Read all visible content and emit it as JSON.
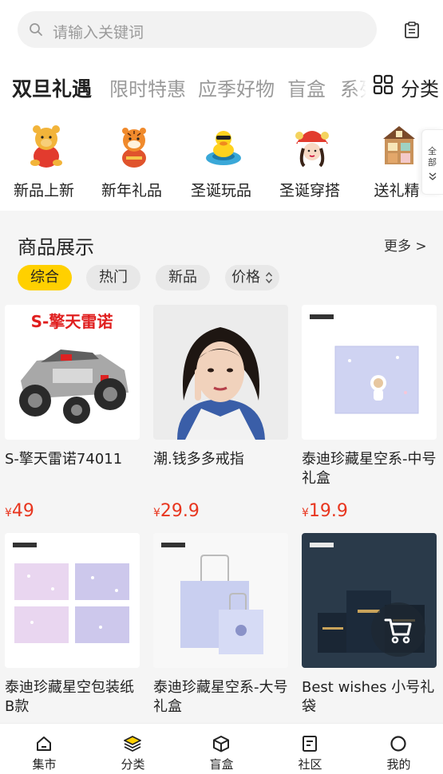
{
  "search": {
    "placeholder": "请输入关键词"
  },
  "tabs": [
    {
      "label": "双旦礼遇"
    },
    {
      "label": "限时特惠"
    },
    {
      "label": "应季好物"
    },
    {
      "label": "盲盒"
    },
    {
      "label": "系列"
    }
  ],
  "category_button": {
    "label": "分类"
  },
  "quick_categories": [
    {
      "label": "新品上新",
      "icon": "pooh-bear-icon"
    },
    {
      "label": "新年礼品",
      "icon": "tiger-plush-icon"
    },
    {
      "label": "圣诞玩品",
      "icon": "duck-float-icon"
    },
    {
      "label": "圣诞穿搭",
      "icon": "lion-hat-girl-icon"
    },
    {
      "label": "送礼精",
      "icon": "dollhouse-icon"
    }
  ],
  "all_button": {
    "label": "全部"
  },
  "section": {
    "title": "商品展示",
    "more": "更多 >"
  },
  "filters": [
    {
      "label": "综合",
      "active": true
    },
    {
      "label": "热门",
      "active": false
    },
    {
      "label": "新品",
      "active": false
    },
    {
      "label": "价格",
      "active": false
    }
  ],
  "products": [
    {
      "name": "S-擎天雷诺74011",
      "price_symbol": "¥",
      "price": "49",
      "image_text": "S-擎天雷诺"
    },
    {
      "name": "潮.钱多多戒指",
      "price_symbol": "¥",
      "price": "29.9",
      "image_text": ""
    },
    {
      "name": "泰迪珍藏星空系-中号礼盒",
      "price_symbol": "¥",
      "price": "19.9",
      "image_text": ""
    },
    {
      "name": "泰迪珍藏星空包装纸B款",
      "price_symbol": "",
      "price": "",
      "image_text": ""
    },
    {
      "name": "泰迪珍藏星空系-大号礼盒",
      "price_symbol": "",
      "price": "",
      "image_text": ""
    },
    {
      "name": "Best wishes 小号礼袋",
      "price_symbol": "",
      "price": "",
      "image_text": ""
    }
  ],
  "bottom_nav": [
    {
      "label": "集市",
      "icon": "home-icon"
    },
    {
      "label": "分类",
      "icon": "layers-icon"
    },
    {
      "label": "盲盒",
      "icon": "box-icon"
    },
    {
      "label": "社区",
      "icon": "document-icon"
    },
    {
      "label": "我的",
      "icon": "profile-circle-icon"
    }
  ],
  "colors": {
    "accent": "#ffd000",
    "price": "#e8361f",
    "background": "#f5f5f5"
  }
}
